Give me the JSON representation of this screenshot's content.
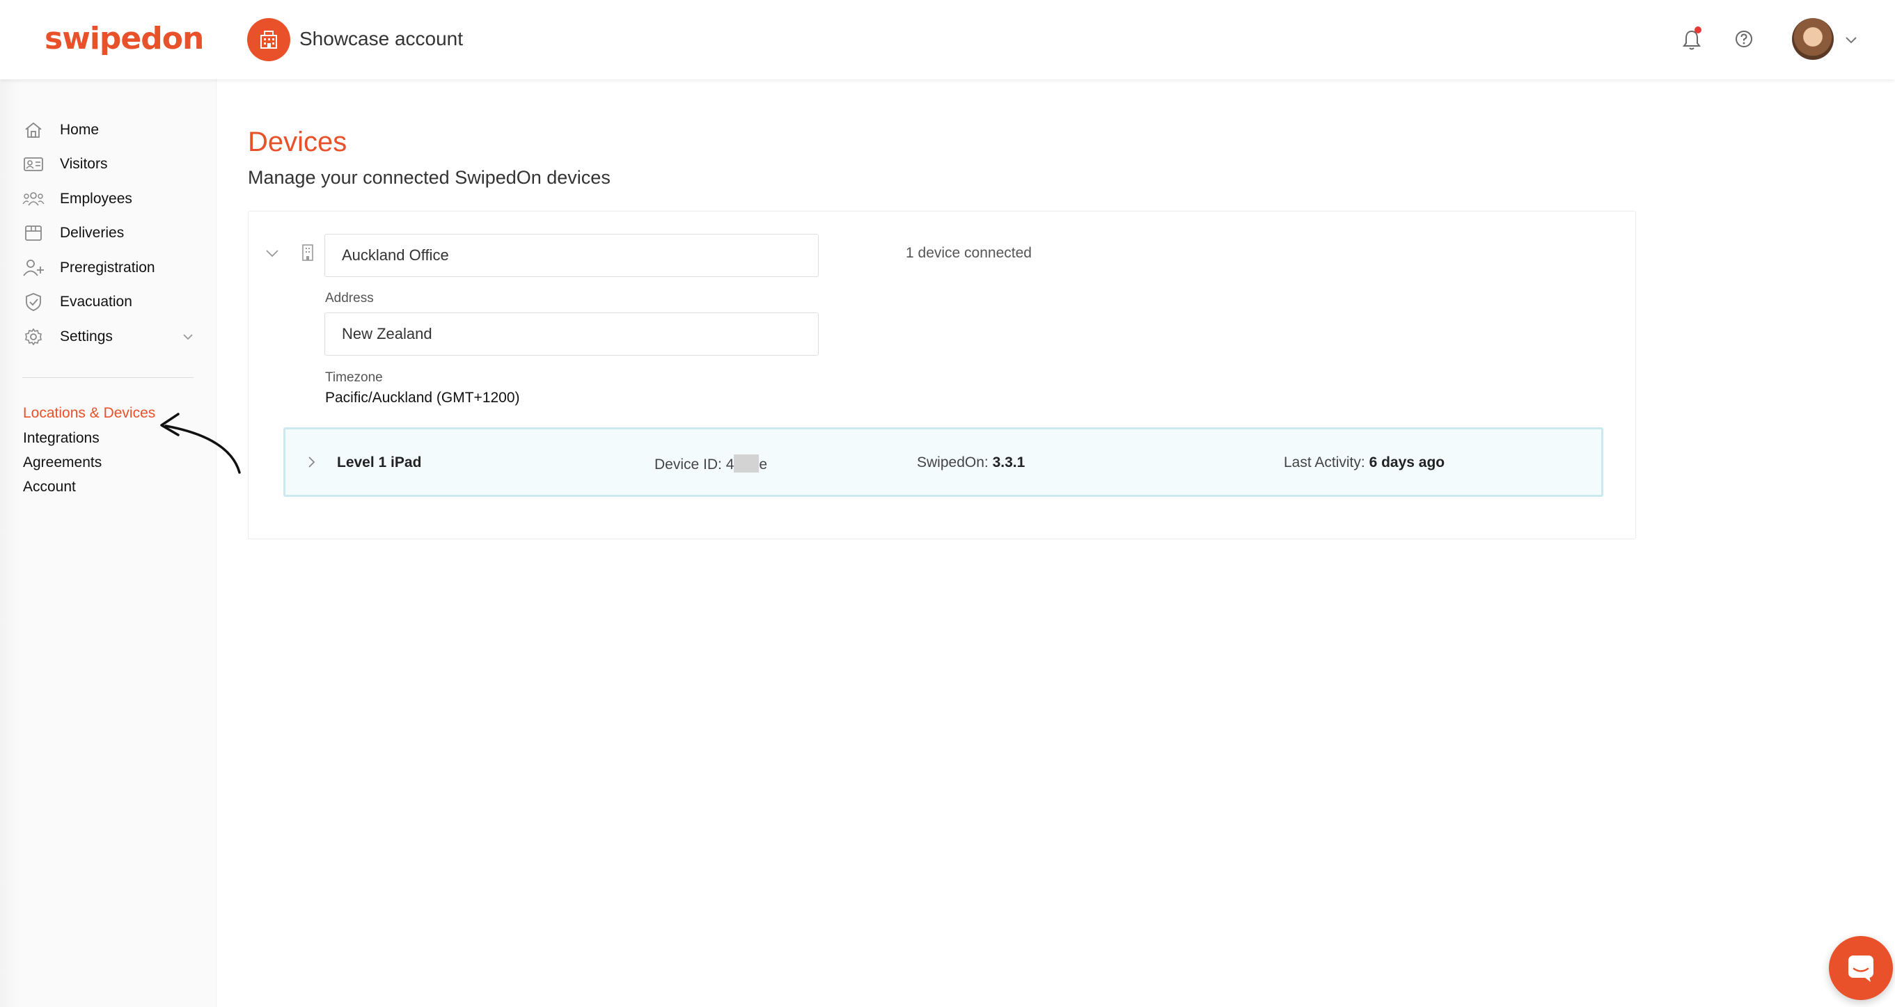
{
  "brand": {
    "logo_text": "swipedon",
    "accent_color": "#e8512a"
  },
  "header": {
    "account_name": "Showcase account",
    "account_icon": "building-icon",
    "notification_icon": "bell-icon",
    "help_icon": "help-circle-icon",
    "avatar_icon": "avatar"
  },
  "sidebar": {
    "items": [
      {
        "label": "Home",
        "icon": "home-icon"
      },
      {
        "label": "Visitors",
        "icon": "id-card-icon"
      },
      {
        "label": "Employees",
        "icon": "people-icon"
      },
      {
        "label": "Deliveries",
        "icon": "box-icon"
      },
      {
        "label": "Preregistration",
        "icon": "add-user-icon"
      },
      {
        "label": "Evacuation",
        "icon": "shield-check-icon"
      },
      {
        "label": "Settings",
        "icon": "gear-icon"
      }
    ],
    "sub_links": [
      {
        "label": "Locations & Devices",
        "active": true
      },
      {
        "label": "Integrations",
        "active": false
      },
      {
        "label": "Agreements",
        "active": false
      },
      {
        "label": "Account",
        "active": false
      }
    ]
  },
  "main": {
    "title": "Devices",
    "subtitle": "Manage your connected SwipedOn devices",
    "location": {
      "name": "Auckland Office",
      "devices_connected": "1 device connected",
      "address_label": "Address",
      "address_value": "New Zealand",
      "timezone_label": "Timezone",
      "timezone_value": "Pacific/Auckland (GMT+1200)",
      "devices": [
        {
          "name": "Level 1 iPad",
          "device_id_label": "Device ID:",
          "device_id_prefix": "4",
          "device_id_suffix": "e",
          "version_label": "SwipedOn:",
          "version_value": "3.3.1",
          "activity_label": "Last Activity:",
          "activity_value": "6 days ago"
        }
      ]
    }
  },
  "chat": {
    "icon": "chat-icon"
  }
}
